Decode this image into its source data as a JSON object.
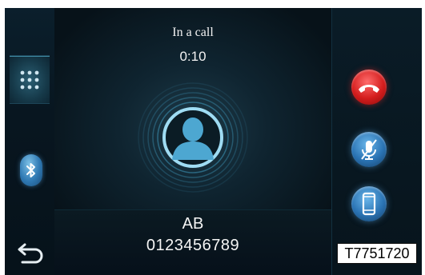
{
  "call": {
    "status": "In a call",
    "timer": "0:10",
    "contact_name": "AB",
    "contact_number": "0123456789"
  },
  "left_rail": {
    "items": [
      {
        "icon": "keypad-icon",
        "active": true
      },
      {
        "icon": "bluetooth-icon",
        "active": false
      },
      {
        "icon": "back-arrow-icon",
        "active": false
      }
    ]
  },
  "right_rail": {
    "buttons": [
      {
        "icon": "hang-up-icon",
        "color": "#d41d1d"
      },
      {
        "icon": "mute-microphone-icon",
        "color": "#2a73b3"
      },
      {
        "icon": "handset-icon",
        "color": "#2a73b3"
      }
    ]
  },
  "figure_ref": "T7751720",
  "colors": {
    "accent_blue": "#2a73b3",
    "hangup_red": "#d41d1d",
    "background": "#020407"
  }
}
